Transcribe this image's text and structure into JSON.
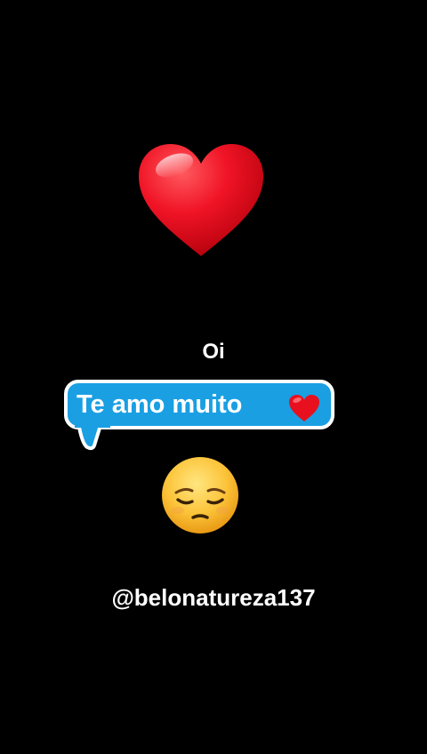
{
  "top_emoji": "heart-icon",
  "greeting": "Oi",
  "message": {
    "text": "Te amo muito",
    "emoji": "heart-icon",
    "bubble_color": "#1a9fe3"
  },
  "reaction_emoji": "pensive-face-icon",
  "handle": "@belonatureza137",
  "colors": {
    "background": "#000000",
    "heart": "#e8101e",
    "text": "#ffffff"
  }
}
